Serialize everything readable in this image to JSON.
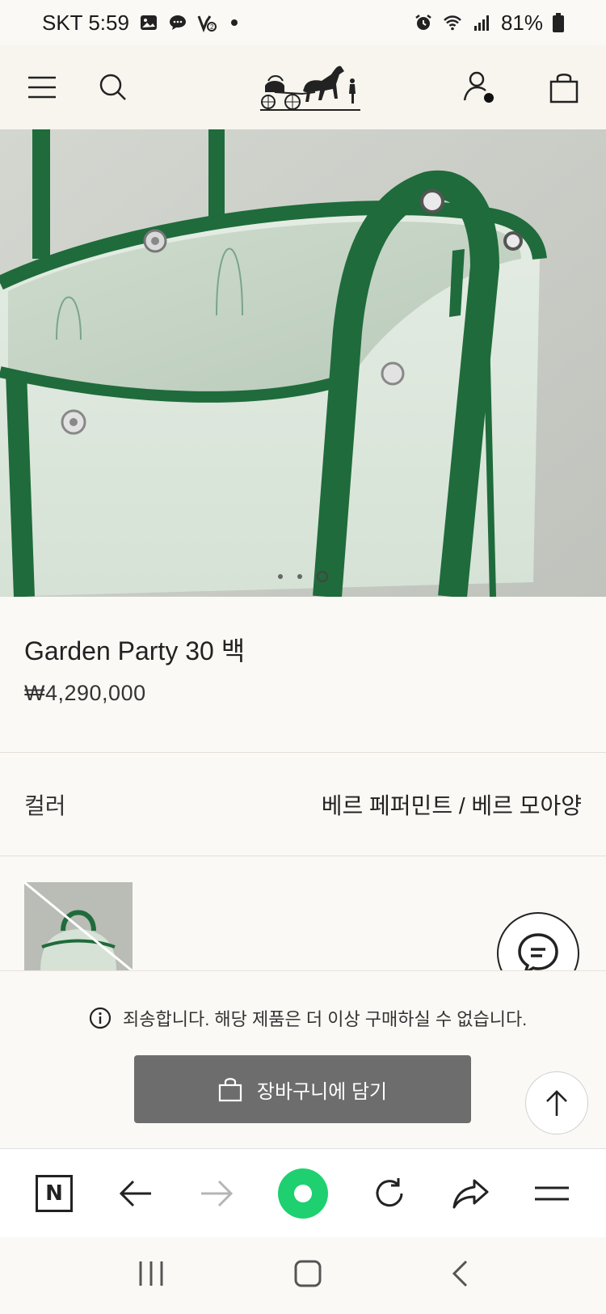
{
  "status_bar": {
    "carrier_time": "SKT 5:59",
    "battery": "81%",
    "icons": [
      "gallery-icon",
      "chat-bubble-icon",
      "app-badge-icon",
      "alarm-icon",
      "wifi-icon",
      "signal-icon",
      "battery-icon"
    ]
  },
  "header": {
    "menu_icon": "hamburger-icon",
    "search_icon": "search-icon",
    "account_icon": "user-icon",
    "bag_icon": "shopping-bag-icon"
  },
  "product": {
    "title": "Garden Party 30 백",
    "price": "₩4,290,000",
    "carousel": {
      "count": 3,
      "active": 3
    }
  },
  "color": {
    "label": "컬러",
    "value": "베르 페퍼민트 / 베르 모아양"
  },
  "purchase": {
    "notice": "죄송합니다. 해당 제품은 더 이상 구매하실 수 없습니다.",
    "cart_button": "장바구니에 담기"
  },
  "browser_bar": {
    "items": [
      "naver-n-icon",
      "back-arrow-icon",
      "forward-arrow-icon",
      "green-dot-button",
      "refresh-icon",
      "share-icon",
      "menu-icon"
    ]
  },
  "colors": {
    "accent_green": "#1ed06f",
    "bag_green": "#1f6b3b",
    "canvas_mint": "#dfe9df",
    "button_gray": "#6d6d6d"
  }
}
